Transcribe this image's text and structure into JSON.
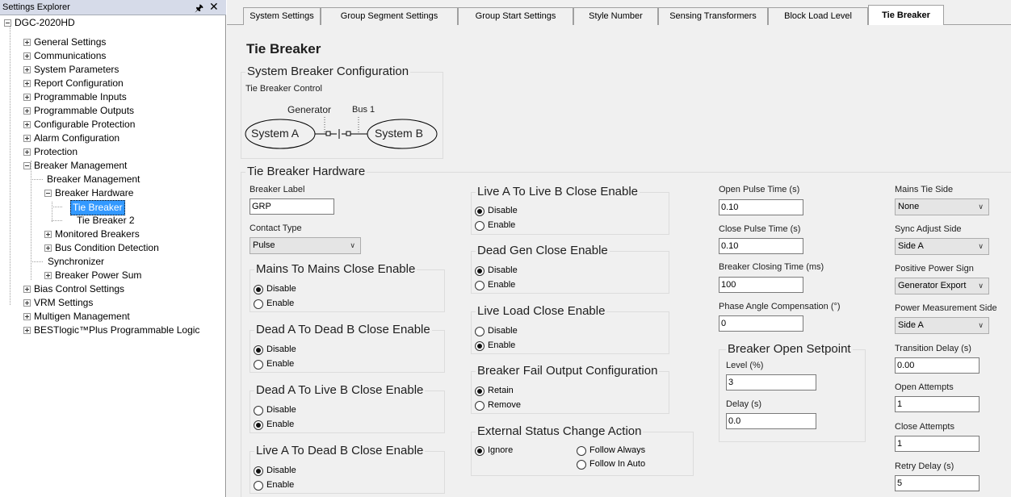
{
  "explorer": {
    "title": "Settings Explorer",
    "pin_icon": "pin-icon",
    "close_icon": "close-icon",
    "tree": [
      {
        "label": "DGC-2020HD",
        "expander": "minus"
      },
      {
        "label": "General Settings",
        "expander": "plus"
      },
      {
        "label": "Communications",
        "expander": "plus"
      },
      {
        "label": "System Parameters",
        "expander": "plus"
      },
      {
        "label": "Report Configuration",
        "expander": "plus"
      },
      {
        "label": "Programmable Inputs",
        "expander": "plus"
      },
      {
        "label": "Programmable Outputs",
        "expander": "plus"
      },
      {
        "label": "Configurable Protection",
        "expander": "plus"
      },
      {
        "label": "Alarm Configuration",
        "expander": "plus"
      },
      {
        "label": "Protection",
        "expander": "plus"
      },
      {
        "label": "Breaker Management",
        "expander": "minus"
      },
      {
        "label": "Breaker Management",
        "expander": "none"
      },
      {
        "label": "Breaker Hardware",
        "expander": "minus"
      },
      {
        "label": "Tie Breaker",
        "expander": "none",
        "selected": true
      },
      {
        "label": "Tie Breaker 2",
        "expander": "none"
      },
      {
        "label": "Monitored Breakers",
        "expander": "plus"
      },
      {
        "label": "Bus Condition Detection",
        "expander": "plus"
      },
      {
        "label": "Synchronizer",
        "expander": "none"
      },
      {
        "label": "Breaker Power Sum",
        "expander": "plus"
      },
      {
        "label": "Bias Control Settings",
        "expander": "plus"
      },
      {
        "label": "VRM Settings",
        "expander": "plus"
      },
      {
        "label": "Multigen Management",
        "expander": "plus"
      },
      {
        "label": "BESTlogic™Plus Programmable Logic",
        "expander": "plus"
      }
    ]
  },
  "tabs": [
    {
      "label": "System Settings"
    },
    {
      "label": "Group Segment Settings"
    },
    {
      "label": "Group Start Settings"
    },
    {
      "label": "Style Number"
    },
    {
      "label": "Sensing Transformers"
    },
    {
      "label": "Block Load Level"
    },
    {
      "label": "Tie Breaker",
      "active": true
    }
  ],
  "page": {
    "title": "Tie Breaker",
    "system_config": {
      "title": "System Breaker Configuration",
      "control_label": "Tie Breaker Control",
      "generator_label": "Generator",
      "bus_label": "Bus 1",
      "system_a": "System A",
      "system_b": "System B",
      "breaker_symbol": "-□|□-"
    },
    "hardware": {
      "title": "Tie Breaker Hardware",
      "breaker_label_caption": "Breaker Label",
      "breaker_label_value": "GRP",
      "contact_type_caption": "Contact Type",
      "contact_type_value": "Pulse",
      "close_enable_groups": [
        {
          "title": "Mains To Mains Close Enable",
          "options": [
            "Disable",
            "Enable"
          ],
          "selected": 0
        },
        {
          "title": "Dead A To Dead B Close Enable",
          "options": [
            "Disable",
            "Enable"
          ],
          "selected": 0
        },
        {
          "title": "Dead A To Live B Close Enable",
          "options": [
            "Disable",
            "Enable"
          ],
          "selected": 1
        },
        {
          "title": "Live A To Dead B Close Enable",
          "options": [
            "Disable",
            "Enable"
          ],
          "selected": 0
        },
        {
          "title": "Live A To Live B Close Enable",
          "options": [
            "Disable",
            "Enable"
          ],
          "selected": 0
        },
        {
          "title": "Dead Gen Close Enable",
          "options": [
            "Disable",
            "Enable"
          ],
          "selected": 0
        },
        {
          "title": "Live Load Close Enable",
          "options": [
            "Disable",
            "Enable"
          ],
          "selected": 1
        },
        {
          "title": "Breaker Fail Output Configuration",
          "options": [
            "Retain",
            "Remove"
          ],
          "selected": 0
        }
      ],
      "external_status": {
        "title": "External Status Change Action",
        "options": [
          "Ignore",
          "Follow Always",
          "Follow In Auto"
        ],
        "selected": 0
      },
      "timing_fields": [
        {
          "label": "Open Pulse Time (s)",
          "value": "0.10"
        },
        {
          "label": "Close Pulse Time (s)",
          "value": "0.10"
        },
        {
          "label": "Breaker Closing Time (ms)",
          "value": "100"
        },
        {
          "label": "Phase Angle Compensation (°)",
          "value": "0"
        }
      ],
      "open_setpoint": {
        "title": "Breaker Open Setpoint",
        "level_label": "Level (%)",
        "level_value": "3",
        "delay_label": "Delay (s)",
        "delay_value": "0.0"
      },
      "right_selects": [
        {
          "label": "Mains Tie Side",
          "value": "None"
        },
        {
          "label": "Sync Adjust Side",
          "value": "Side A"
        },
        {
          "label": "Positive Power Sign",
          "value": "Generator Export"
        },
        {
          "label": "Power Measurement Side",
          "value": "Side A"
        }
      ],
      "right_fields": [
        {
          "label": "Transition Delay (s)",
          "value": "0.00"
        },
        {
          "label": "Open Attempts",
          "value": "1"
        },
        {
          "label": "Close Attempts",
          "value": "1"
        },
        {
          "label": "Retry Delay (s)",
          "value": "5"
        }
      ]
    }
  }
}
